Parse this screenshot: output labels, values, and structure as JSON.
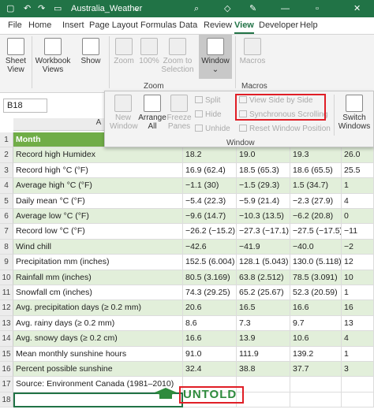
{
  "titlebar": {
    "file_name": "Australia_Weather"
  },
  "ribbon_tabs": [
    "File",
    "Home",
    "Insert",
    "Page Layout",
    "Formulas",
    "Data",
    "Review",
    "View",
    "Developer",
    "Help"
  ],
  "active_tab": "View",
  "ribbon": {
    "sheet_view": "Sheet\nView",
    "workbook_views": "Workbook\nViews",
    "show": "Show",
    "zoom": "Zoom",
    "zoom_100": "100%",
    "zoom_to_selection": "Zoom to\nSelection",
    "window": "Window",
    "macros": "Macros",
    "zoom_group": "Zoom",
    "macros_group": "Macros"
  },
  "name_box": "B18",
  "window_dropdown": {
    "new_window": "New\nWindow",
    "arrange_all": "Arrange\nAll",
    "freeze_panes": "Freeze\nPanes",
    "split": "Split",
    "hide": "Hide",
    "unhide": "Unhide",
    "view_side_by_side": "View Side by Side",
    "synchronous_scrolling": "Synchronous Scrolling",
    "reset_window_position": "Reset Window Position",
    "switch_windows": "Switch\nWindows",
    "group_label": "Window"
  },
  "column_header_visible": "A",
  "rows": [
    {
      "n": "1",
      "label": "Month",
      "b": "",
      "c": "",
      "d": "",
      "e": ""
    },
    {
      "n": "2",
      "label": "Record high Humidex",
      "b": "18.2",
      "c": "19.0",
      "d": "19.3",
      "e": "26.0"
    },
    {
      "n": "3",
      "label": "Record high °C (°F)",
      "b": "16.9 (62.4)",
      "c": "18.5 (65.3)",
      "d": "18.6 (65.5)",
      "e": "25.5"
    },
    {
      "n": "4",
      "label": "Average high °C (°F)",
      "b": "−1.1 (30)",
      "c": "−1.5 (29.3)",
      "d": "1.5 (34.7)",
      "e": "1"
    },
    {
      "n": "5",
      "label": "Daily mean °C (°F)",
      "b": "−5.4 (22.3)",
      "c": "−5.9 (21.4)",
      "d": "−2.3 (27.9)",
      "e": "4"
    },
    {
      "n": "6",
      "label": "Average low °C (°F)",
      "b": "−9.6 (14.7)",
      "c": "−10.3 (13.5)",
      "d": "−6.2 (20.8)",
      "e": "0"
    },
    {
      "n": "7",
      "label": "Record low °C (°F)",
      "b": "−26.2 (−15.2)",
      "c": "−27.3 (−17.1)",
      "d": "−27.5 (−17.5)",
      "e": "−11"
    },
    {
      "n": "8",
      "label": "Wind chill",
      "b": "−42.6",
      "c": "−41.9",
      "d": "−40.0",
      "e": "−2"
    },
    {
      "n": "9",
      "label": "Precipitation mm (inches)",
      "b": "152.5 (6.004)",
      "c": "128.1 (5.043)",
      "d": "130.0 (5.118)",
      "e": "12"
    },
    {
      "n": "10",
      "label": "Rainfall mm (inches)",
      "b": "80.5 (3.169)",
      "c": "63.8 (2.512)",
      "d": "78.5 (3.091)",
      "e": "10"
    },
    {
      "n": "11",
      "label": "Snowfall cm (inches)",
      "b": "74.3 (29.25)",
      "c": "65.2 (25.67)",
      "d": "52.3 (20.59)",
      "e": "1"
    },
    {
      "n": "12",
      "label": "Avg. precipitation days (≥ 0.2 mm)",
      "b": "20.6",
      "c": "16.5",
      "d": "16.6",
      "e": "16"
    },
    {
      "n": "13",
      "label": "Avg. rainy days (≥ 0.2 mm)",
      "b": "8.6",
      "c": "7.3",
      "d": "9.7",
      "e": "13"
    },
    {
      "n": "14",
      "label": "Avg. snowy days (≥ 0.2 cm)",
      "b": "16.6",
      "c": "13.9",
      "d": "10.6",
      "e": "4"
    },
    {
      "n": "15",
      "label": "Mean monthly sunshine hours",
      "b": "91.0",
      "c": "111.9",
      "d": "139.2",
      "e": "1"
    },
    {
      "n": "16",
      "label": "Percent possible sunshine",
      "b": "32.4",
      "c": "38.8",
      "d": "37.7",
      "e": "3"
    },
    {
      "n": "17",
      "label": "Source: Environment Canada (1981–2010)",
      "b": "",
      "c": "",
      "d": "",
      "e": ""
    },
    {
      "n": "18",
      "label": "",
      "b": "",
      "c": "",
      "d": "",
      "e": ""
    }
  ],
  "watermark": "UNTOLD",
  "colors": {
    "excel_green": "#217346",
    "header_green": "#70ad47",
    "band_green": "#e2efda",
    "highlight_red": "#e01e26"
  }
}
